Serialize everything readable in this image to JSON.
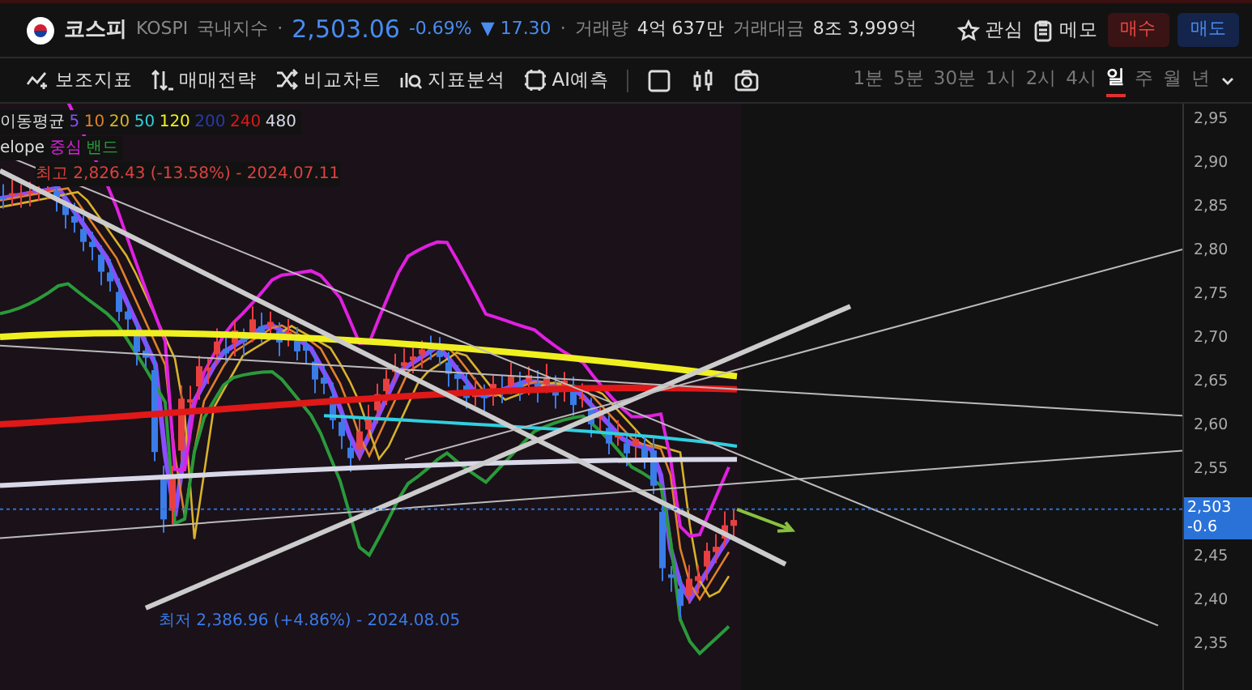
{
  "header": {
    "name": "코스피",
    "code": "KOSPI",
    "market": "국내지수",
    "separator": "·",
    "price": "2,503.06",
    "change_pct": "-0.69%",
    "change": "▼ 17.30",
    "separator_2": "·",
    "volume_label": "거래량",
    "volume": "4억 637만",
    "amount_label": "거래대금",
    "amount": "8조 3,999억",
    "actions": [
      {
        "kind": "star",
        "label": "관심"
      },
      {
        "kind": "memo",
        "label": "메모"
      }
    ],
    "buy": "매수",
    "sell": "매도"
  },
  "toolbar": {
    "tools": [
      {
        "kind": "indicator",
        "label": "보조지표"
      },
      {
        "kind": "strategy",
        "label": "매매전략"
      },
      {
        "kind": "compare",
        "label": "비교차트"
      },
      {
        "kind": "analysis",
        "label": "지표분석"
      },
      {
        "kind": "ai",
        "label": "AI예측"
      }
    ],
    "periods": [
      {
        "label": "1분",
        "selected": false
      },
      {
        "label": "5분",
        "selected": false
      },
      {
        "label": "30분",
        "selected": false
      },
      {
        "label": "1시",
        "selected": false
      },
      {
        "label": "2시",
        "selected": false
      },
      {
        "label": "4시",
        "selected": false
      },
      {
        "label": "일",
        "selected": true
      },
      {
        "label": "주",
        "selected": false
      },
      {
        "label": "월",
        "selected": false
      },
      {
        "label": "년",
        "selected": false
      }
    ]
  },
  "chart": {
    "legend_ma": {
      "label": "이동평균",
      "periods": [
        {
          "label": "5",
          "color": "#8a4dff"
        },
        {
          "label": "10",
          "color": "#e0802a"
        },
        {
          "label": "20",
          "color": "#d8b22a"
        },
        {
          "label": "50",
          "color": "#2fd0e0"
        },
        {
          "label": "120",
          "color": "#f0f020"
        },
        {
          "label": "200",
          "color": "#2a38b0"
        },
        {
          "label": "240",
          "color": "#e01818"
        },
        {
          "label": "480",
          "color": "#d8d8e8"
        }
      ]
    },
    "legend_envelope": {
      "label": "elope",
      "center": "중심",
      "band": "밴드"
    },
    "high_label": "최고 2,826.43 (-13.58%) - 2024.07.11",
    "low_label": "최저 2,386.96 (+4.86%) - 2024.08.05",
    "y_axis": [
      "2,95",
      "2,90",
      "2,85",
      "2,80",
      "2,75",
      "2,70",
      "2,65",
      "2,60",
      "2,55",
      "2,45",
      "2,40",
      "2,35"
    ],
    "price_tag": {
      "price": "2,503",
      "change": "-0.6"
    }
  }
}
